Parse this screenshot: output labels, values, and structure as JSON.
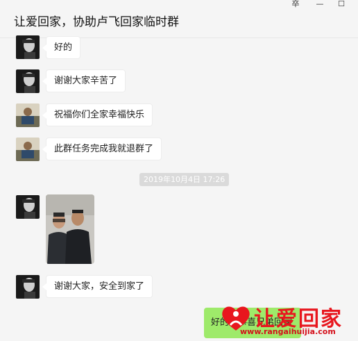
{
  "window": {
    "title": "让爱回家，协助卢飞回家临时群",
    "pin_icon": "pin-icon",
    "minimize_icon": "minimize-icon",
    "maximize_icon": "maximize-icon",
    "pin_glyph": "卒",
    "minimize_glyph": "—",
    "maximize_glyph": "☐"
  },
  "messages": [
    {
      "sender": "dark-avatar",
      "text": "好的"
    },
    {
      "sender": "dark-avatar",
      "text": "谢谢大家辛苦了"
    },
    {
      "sender": "light-avatar",
      "text": "祝福你们全家幸福快乐"
    },
    {
      "sender": "light-avatar",
      "text": "此群任务完成我就退群了"
    },
    {
      "sender": "dark-avatar",
      "text": "谢谢大家，安全到家了"
    }
  ],
  "timestamp": "2019年10月4日 17:26",
  "photo_message": {
    "sender": "dark-avatar",
    "kind": "photo of two men"
  },
  "outgoing_message": {
    "text": "好的，恭喜兄弟回家"
  },
  "watermark": {
    "brand": "让爱回家",
    "url": "www.rangaihuijia.com"
  },
  "colors": {
    "background": "#f5f5f5",
    "bubble_incoming": "#ffffff",
    "bubble_outgoing": "#9eea6a",
    "timestamp_bg": "#dadada",
    "watermark_red": "#e8161e"
  }
}
